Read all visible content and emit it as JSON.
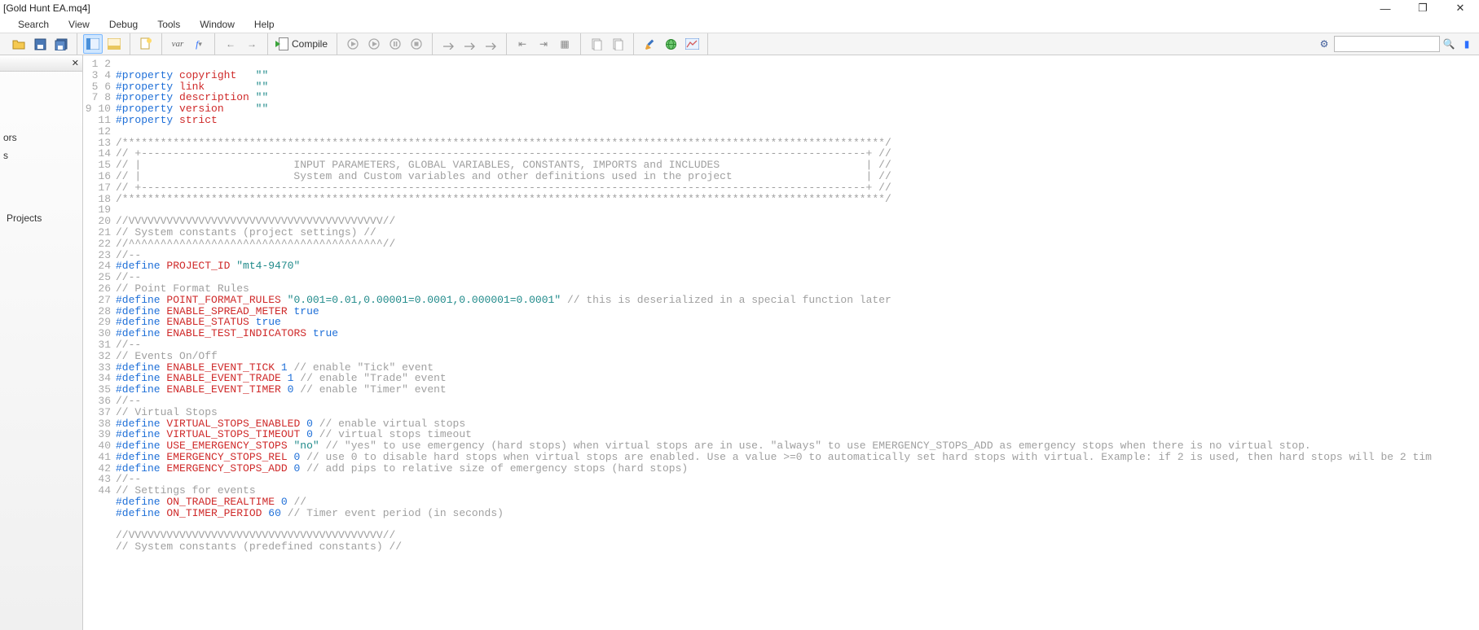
{
  "title": "[Gold Hunt EA.mq4]",
  "menu": [
    "Search",
    "View",
    "Debug",
    "Tools",
    "Window",
    "Help"
  ],
  "compile_label": "Compile",
  "var_label": "var",
  "sidebar": {
    "items": [
      "ors",
      "s",
      "Projects"
    ]
  },
  "search": {
    "placeholder": ""
  },
  "code": [
    {
      "n": 1,
      "t": ""
    },
    {
      "n": 2,
      "t": "#property copyright   \"\""
    },
    {
      "n": 3,
      "t": "#property link        \"\""
    },
    {
      "n": 4,
      "t": "#property description \"\""
    },
    {
      "n": 5,
      "t": "#property version     \"\""
    },
    {
      "n": 6,
      "t": "#property strict"
    },
    {
      "n": 7,
      "t": ""
    },
    {
      "n": 8,
      "t": "/************************************************************************************************************************/"
    },
    {
      "n": 9,
      "t": "// +------------------------------------------------------------------------------------------------------------------+ //"
    },
    {
      "n": 10,
      "t": "// |                        INPUT PARAMETERS, GLOBAL VARIABLES, CONSTANTS, IMPORTS and INCLUDES                       | //"
    },
    {
      "n": 11,
      "t": "// |                        System and Custom variables and other definitions used in the project                     | //"
    },
    {
      "n": 12,
      "t": "// +------------------------------------------------------------------------------------------------------------------+ //"
    },
    {
      "n": 13,
      "t": "/************************************************************************************************************************/"
    },
    {
      "n": 14,
      "t": ""
    },
    {
      "n": 15,
      "t": "//VVVVVVVVVVVVVVVVVVVVVVVVVVVVVVVVVVVVVVVV//"
    },
    {
      "n": 16,
      "t": "// System constants (project settings) //"
    },
    {
      "n": 17,
      "t": "//^^^^^^^^^^^^^^^^^^^^^^^^^^^^^^^^^^^^^^^^//"
    },
    {
      "n": 18,
      "t": "//--"
    },
    {
      "n": 19,
      "t": "#define PROJECT_ID \"mt4-9470\""
    },
    {
      "n": 20,
      "t": "//--"
    },
    {
      "n": 21,
      "t": "// Point Format Rules"
    },
    {
      "n": 22,
      "t": "#define POINT_FORMAT_RULES \"0.001=0.01,0.00001=0.0001,0.000001=0.0001\" // this is deserialized in a special function later"
    },
    {
      "n": 23,
      "t": "#define ENABLE_SPREAD_METER true"
    },
    {
      "n": 24,
      "t": "#define ENABLE_STATUS true"
    },
    {
      "n": 25,
      "t": "#define ENABLE_TEST_INDICATORS true"
    },
    {
      "n": 26,
      "t": "//--"
    },
    {
      "n": 27,
      "t": "// Events On/Off"
    },
    {
      "n": 28,
      "t": "#define ENABLE_EVENT_TICK 1 // enable \"Tick\" event"
    },
    {
      "n": 29,
      "t": "#define ENABLE_EVENT_TRADE 1 // enable \"Trade\" event"
    },
    {
      "n": 30,
      "t": "#define ENABLE_EVENT_TIMER 0 // enable \"Timer\" event"
    },
    {
      "n": 31,
      "t": "//--"
    },
    {
      "n": 32,
      "t": "// Virtual Stops"
    },
    {
      "n": 33,
      "t": "#define VIRTUAL_STOPS_ENABLED 0 // enable virtual stops"
    },
    {
      "n": 34,
      "t": "#define VIRTUAL_STOPS_TIMEOUT 0 // virtual stops timeout"
    },
    {
      "n": 35,
      "t": "#define USE_EMERGENCY_STOPS \"no\" // \"yes\" to use emergency (hard stops) when virtual stops are in use. \"always\" to use EMERGENCY_STOPS_ADD as emergency stops when there is no virtual stop."
    },
    {
      "n": 36,
      "t": "#define EMERGENCY_STOPS_REL 0 // use 0 to disable hard stops when virtual stops are enabled. Use a value >=0 to automatically set hard stops with virtual. Example: if 2 is used, then hard stops will be 2 tim"
    },
    {
      "n": 37,
      "t": "#define EMERGENCY_STOPS_ADD 0 // add pips to relative size of emergency stops (hard stops)"
    },
    {
      "n": 38,
      "t": "//--"
    },
    {
      "n": 39,
      "t": "// Settings for events"
    },
    {
      "n": 40,
      "t": "#define ON_TRADE_REALTIME 0 //"
    },
    {
      "n": 41,
      "t": "#define ON_TIMER_PERIOD 60 // Timer event period (in seconds)"
    },
    {
      "n": 42,
      "t": ""
    },
    {
      "n": 43,
      "t": "//VVVVVVVVVVVVVVVVVVVVVVVVVVVVVVVVVVVVVVVV//"
    },
    {
      "n": 44,
      "t": "// System constants (predefined constants) //"
    }
  ]
}
